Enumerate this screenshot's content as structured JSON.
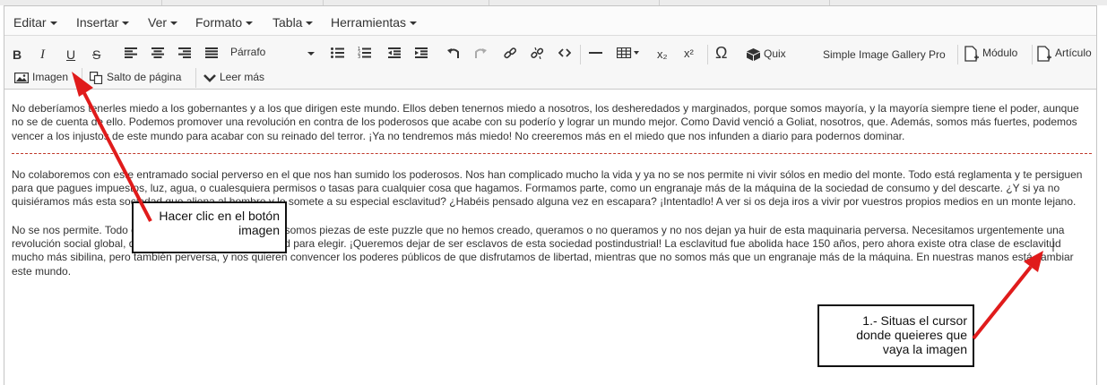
{
  "menubar": {
    "items": [
      "Editar",
      "Insertar",
      "Ver",
      "Formato",
      "Tabla",
      "Herramientas"
    ]
  },
  "toolbar": {
    "row1": {
      "bold": "B",
      "italic": "I",
      "underline": "U",
      "strike": "S",
      "format_select": "Párrafo",
      "subscript": "x₂",
      "superscript": "x²",
      "omega": "Ω",
      "quix": "Quix",
      "gallery": "Simple Image Gallery Pro",
      "module": "Módulo",
      "article": "Artículo"
    },
    "row2": {
      "image": "Imagen",
      "pagebreak": "Salto de página",
      "readmore": "Leer más"
    }
  },
  "content": {
    "p1": "No deberíamos tenerles miedo a los gobernantes y a los que dirigen este mundo. Ellos deben tenernos miedo a nosotros, los desheredados y marginados, porque somos mayoría, y la mayoría siempre tiene el poder, aunque no se de cuenta de ello. Podemos promover una revolución en contra de los poderosos que acabe con su poderío y lograr un mundo mejor. Como David venció a Goliat, nosotros, que. Además, somos más fuertes, podemos vencer a los injustos de este mundo para acabar con su reinado del terror. ¡Ya no tendremos más miedo! No creeremos más en el miedo que nos infunden a diario para podernos dominar.",
    "p2": "No colaboremos con este entramado social perverso en el que nos han sumido los poderosos. Nos han complicado mucho la vida y ya no se nos permite ni vivir sólos en medio del monte. Todo está reglamenta y te persiguen para que pagues impuestos, luz, agua, o cualesquiera permisos o tasas para cualquier cosa que hagamos. Formamos parte, como un engranaje más de la máquina de la sociedad de consumo y del descarte. ¿Y si ya no quisiéramos más esta sociedad que aliena al hombre y lo somete a su especial esclavitud? ¿Habéis pensado alguna vez en escapara? ¡Intentadlo! A ver si os deja iros a vivir por vuestros propios medios en un monte lejano.",
    "p3": "No se nos permite. Todo está reglamentado y regulado y somos piezas de este puzzle que no hemos creado, queramos o no queramos y no nos dejan ya huir de esta maquinaria perversa. Necesitamos urgentemente una revolución social global, que nos devuelva nuestra libertad para elegir. ¡Queremos dejar de ser esclavos de esta sociedad postindustrial! La esclavitud fue abolida hace 150 años, pero ahora existe otra clase de esclavitud mucho más sibilina, pero también perversa, y nos quieren convencer los poderes públicos de que disfrutamos de libertad, mientras que no somos más que un engranaje más de la máquina. En nuestras manos está cambiar este mundo."
  },
  "annotations": {
    "callout1": "Hacer clic en el botón imagen",
    "callout2": "1.- Situas el cursor donde queieres que vaya la imagen",
    "arrow_color": "#e01b1b"
  }
}
